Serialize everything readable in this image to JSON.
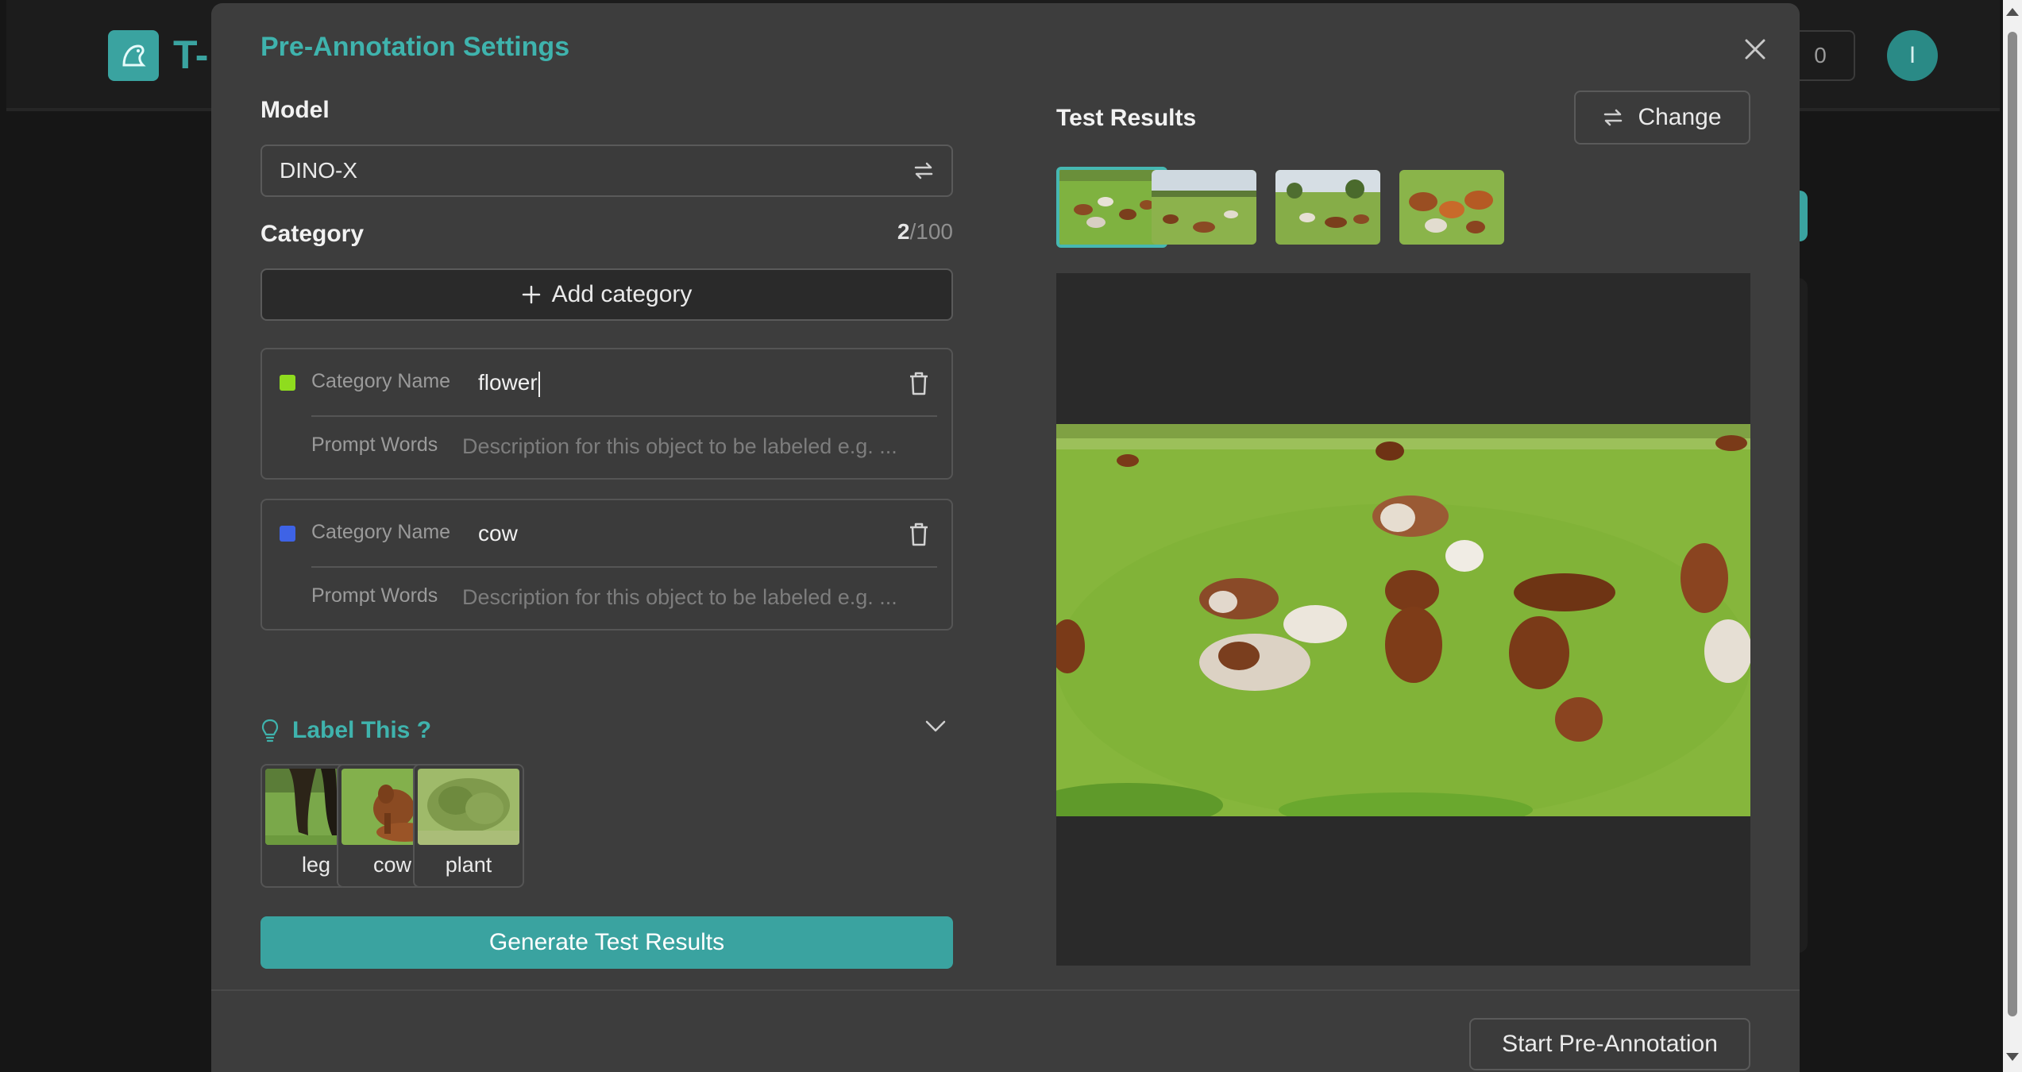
{
  "app": {
    "logo_text": "T-",
    "counter": "0",
    "avatar_initial": "I"
  },
  "modal": {
    "title": "Pre-Annotation Settings"
  },
  "model": {
    "label": "Model",
    "value": "DINO-X"
  },
  "category": {
    "label": "Category",
    "count": "2",
    "max": "/100",
    "add_label": "Add category",
    "items": [
      {
        "color": "#8fdc1e",
        "name_label": "Category Name",
        "name_value": "flower",
        "prompt_label": "Prompt Words",
        "prompt_placeholder": "Description for this object to be labeled e.g. ..."
      },
      {
        "color": "#3e63e6",
        "name_label": "Category Name",
        "name_value": "cow",
        "prompt_label": "Prompt Words",
        "prompt_placeholder": "Description for this object to be labeled e.g. ..."
      }
    ]
  },
  "label_this": {
    "title": "Label This ?",
    "suggestions": [
      {
        "label": "leg",
        "icon": "leg-thumbnail"
      },
      {
        "label": "cow",
        "icon": "cow-thumbnail"
      },
      {
        "label": "plant",
        "icon": "plant-thumbnail"
      }
    ]
  },
  "actions": {
    "generate": "Generate Test Results",
    "start": "Start Pre-Annotation"
  },
  "test_results": {
    "title": "Test Results",
    "change_label": "Change",
    "thumbnails": [
      "pasture-cows-1",
      "pasture-cows-2",
      "pasture-cows-3",
      "pasture-cows-4"
    ],
    "selected_index": 0
  },
  "colors": {
    "accent": "#3aa3a0",
    "title_accent": "#3fb3ad",
    "modal_bg": "#3d3d3d"
  }
}
